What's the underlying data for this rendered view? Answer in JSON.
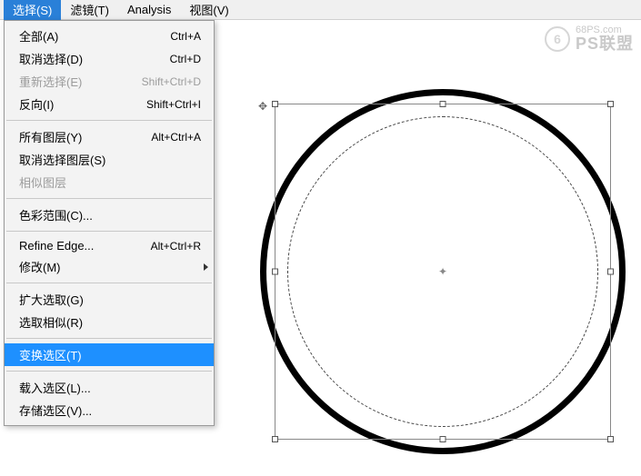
{
  "menubar": {
    "select": "选择(S)",
    "filter": "滤镜(T)",
    "analysis": "Analysis",
    "view": "视图(V)"
  },
  "menu": {
    "all": {
      "label": "全部(A)",
      "shortcut": "Ctrl+A"
    },
    "deselect": {
      "label": "取消选择(D)",
      "shortcut": "Ctrl+D"
    },
    "reselect": {
      "label": "重新选择(E)",
      "shortcut": "Shift+Ctrl+D"
    },
    "inverse": {
      "label": "反向(I)",
      "shortcut": "Shift+Ctrl+I"
    },
    "allLayers": {
      "label": "所有图层(Y)",
      "shortcut": "Alt+Ctrl+A"
    },
    "deselectLayers": {
      "label": "取消选择图层(S)",
      "shortcut": ""
    },
    "similarLayers": {
      "label": "相似图层",
      "shortcut": ""
    },
    "colorRange": {
      "label": "色彩范围(C)...",
      "shortcut": ""
    },
    "refineEdge": {
      "label": "Refine Edge...",
      "shortcut": "Alt+Ctrl+R"
    },
    "modify": {
      "label": "修改(M)",
      "shortcut": ""
    },
    "grow": {
      "label": "扩大选取(G)",
      "shortcut": ""
    },
    "similar": {
      "label": "选取相似(R)",
      "shortcut": ""
    },
    "transform": {
      "label": "变换选区(T)",
      "shortcut": ""
    },
    "load": {
      "label": "载入选区(L)...",
      "shortcut": ""
    },
    "save": {
      "label": "存储选区(V)...",
      "shortcut": ""
    }
  },
  "watermark": {
    "site": "68PS.com",
    "logoGlyph": "6",
    "brand": "PS联盟"
  }
}
